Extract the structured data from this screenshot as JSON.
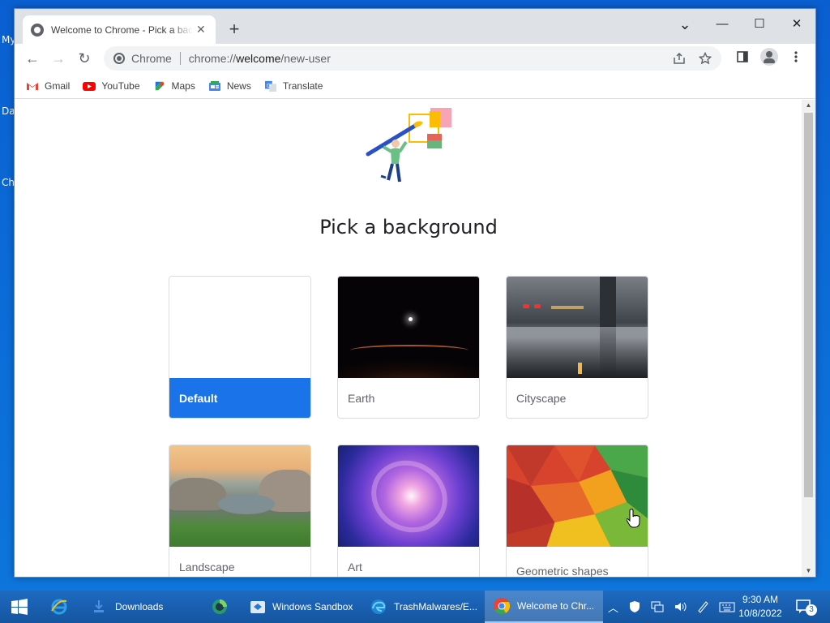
{
  "desktop": {
    "icons": [
      "My",
      "Da",
      "Ch"
    ]
  },
  "browser": {
    "tab": {
      "title": "Welcome to Chrome - Pick a background",
      "close": "✕"
    },
    "new_tab": "+",
    "window_controls": {
      "tab_search": "⌄",
      "minimize": "—",
      "maximize": "☐",
      "close": "✕"
    },
    "nav": {
      "back": "←",
      "forward": "→",
      "reload": "↻"
    },
    "omnibox": {
      "chip_label": "Chrome",
      "url_prefix": "chrome://",
      "url_host": "welcome",
      "url_path": "/new-user"
    },
    "bookmarks": [
      {
        "label": "Gmail",
        "icon": "gmail-icon"
      },
      {
        "label": "YouTube",
        "icon": "youtube-icon"
      },
      {
        "label": "Maps",
        "icon": "maps-icon"
      },
      {
        "label": "News",
        "icon": "news-icon"
      },
      {
        "label": "Translate",
        "icon": "translate-icon"
      }
    ]
  },
  "page": {
    "heading": "Pick a background",
    "backgrounds": [
      {
        "label": "Default",
        "selected": true
      },
      {
        "label": "Earth",
        "selected": false
      },
      {
        "label": "Cityscape",
        "selected": false
      },
      {
        "label": "Landscape",
        "selected": false
      },
      {
        "label": "Art",
        "selected": false
      },
      {
        "label": "Geometric shapes",
        "selected": false
      }
    ],
    "accent_color": "#1a73e8"
  },
  "taskbar": {
    "items": [
      {
        "label": "Downloads",
        "icon": "folder-icon"
      },
      {
        "label": "",
        "icon": "edge-dev-icon"
      },
      {
        "label": "Windows Sandbox",
        "icon": "sandbox-icon"
      },
      {
        "label": "TrashMalwares/E...",
        "icon": "edge-icon"
      },
      {
        "label": "Welcome to Chr...",
        "icon": "chrome-icon",
        "active": true
      }
    ],
    "clock": {
      "time": "9:30 AM",
      "date": "10/8/2022"
    },
    "notification_count": "3"
  }
}
